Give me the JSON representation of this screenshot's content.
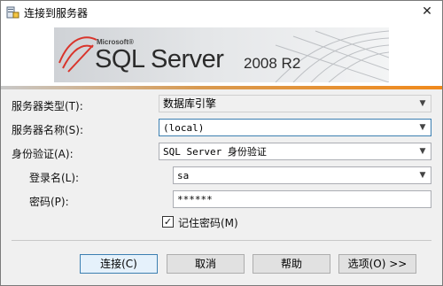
{
  "window": {
    "title": "连接到服务器",
    "close_glyph": "✕"
  },
  "banner": {
    "brand": "Microsoft®",
    "product": "SQL Server",
    "version": "2008 R2"
  },
  "form": {
    "server_type": {
      "label": "服务器类型(T):",
      "value": "数据库引擎"
    },
    "server_name": {
      "label": "服务器名称(S):",
      "value": "(local)"
    },
    "auth": {
      "label": "身份验证(A):",
      "value": "SQL Server 身份验证"
    },
    "login": {
      "label": "登录名(L):",
      "value": "sa"
    },
    "password": {
      "label": "密码(P):",
      "value": "******"
    },
    "remember": {
      "label": "记住密码(M)",
      "checked": true,
      "check_glyph": "✓"
    }
  },
  "buttons": {
    "connect": "连接(C)",
    "cancel": "取消",
    "help": "帮助",
    "options": "选项(O) >>"
  },
  "icons": {
    "app": "server-connect-icon",
    "dropdown": "chevron-down-icon"
  }
}
